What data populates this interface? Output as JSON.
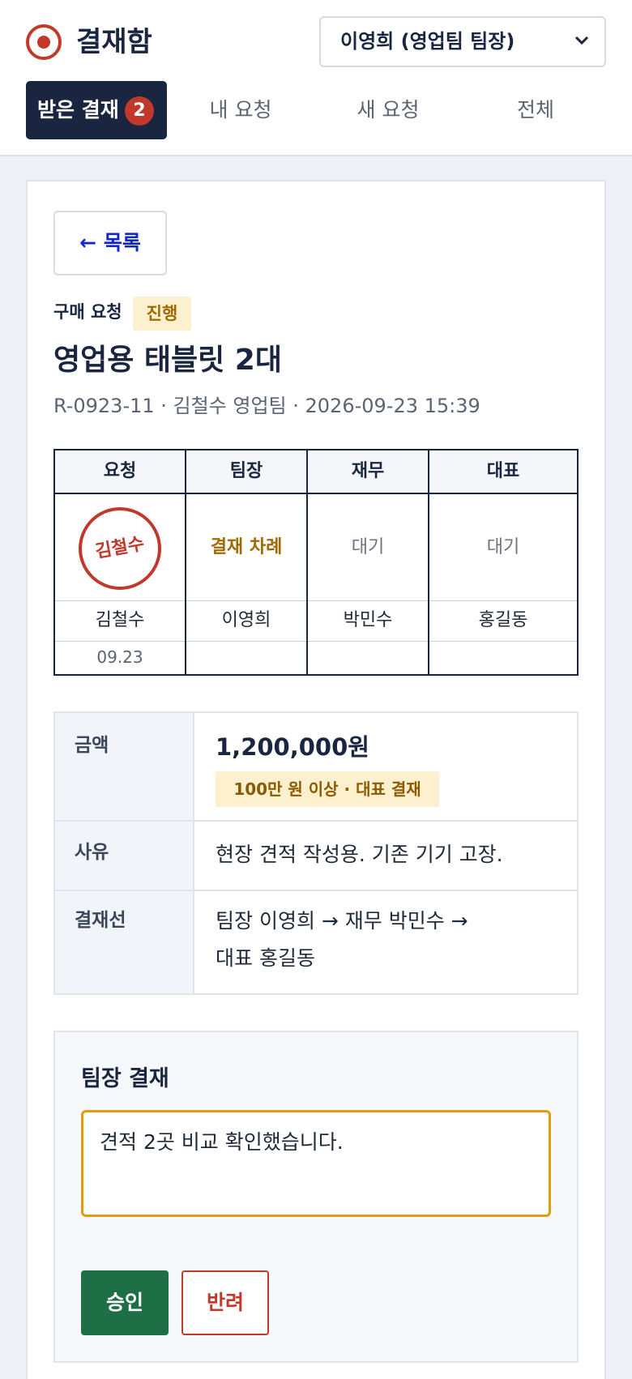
{
  "app": {
    "title": "결재함"
  },
  "user_select": {
    "selected": "이영희 (영업팀 팀장)"
  },
  "tabs": [
    {
      "label": "받은 결재",
      "badge": "2"
    },
    {
      "label": "내 요청"
    },
    {
      "label": "새 요청"
    },
    {
      "label": "전체"
    }
  ],
  "back_button": "← 목록",
  "doc": {
    "type": "구매 요청",
    "status": "진행",
    "title": "영업용 태블릿 2대",
    "meta": "R-0923-11 · 김철수 영업팀 · 2026-09-23 15:39"
  },
  "approval": [
    {
      "role": "요청",
      "stamp": "김철수",
      "name": "김철수",
      "date": "09.23"
    },
    {
      "role": "팀장",
      "state": "결재 차례",
      "name": "이영희",
      "date": ""
    },
    {
      "role": "재무",
      "state": "대기",
      "name": "박민수",
      "date": ""
    },
    {
      "role": "대표",
      "state": "대기",
      "name": "홍길동",
      "date": ""
    }
  ],
  "info": {
    "amount_label": "금액",
    "amount": "1,200,000원",
    "amount_note": "100만 원 이상 · 대표 결재",
    "reason_label": "사유",
    "reason": "현장 견적 작성용. 기존 기기 고장.",
    "line_label": "결재선",
    "line_1": "팀장 이영희 → 재무 박민수 →",
    "line_2": "대표 홍길동"
  },
  "decision": {
    "title": "팀장 결재",
    "comment": "견적 2곳 비교 확인했습니다.",
    "approve": "승인",
    "reject": "반려"
  },
  "colors": {
    "navy": "#1a2540",
    "red": "#c0392b",
    "amber": "#e39b12",
    "green": "#1e6f46"
  }
}
